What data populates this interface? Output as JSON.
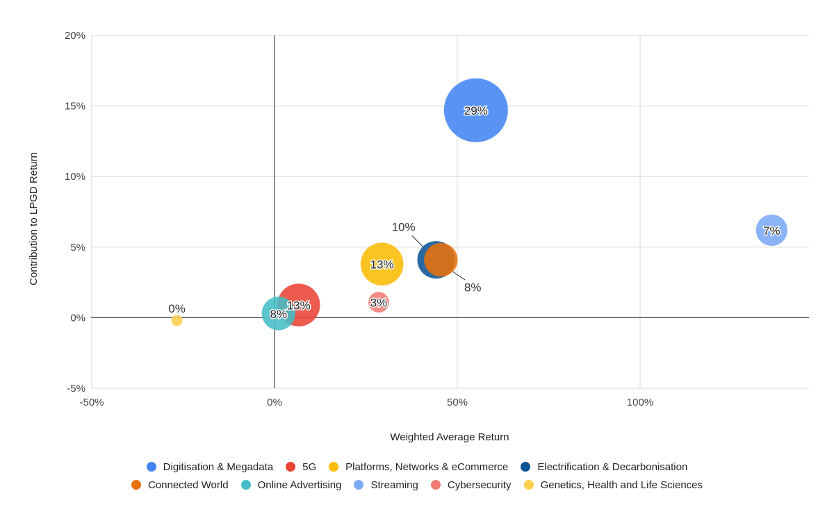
{
  "chart_data": {
    "type": "scatter",
    "subtype": "bubble",
    "title": "",
    "xlabel": "Weighted Average Return",
    "ylabel": "Contribution to LPGD Return",
    "xlim": [
      -50,
      146
    ],
    "ylim": [
      -5,
      20
    ],
    "x_ticks": [
      -50,
      0,
      50,
      100
    ],
    "x_tick_labels": [
      "-50%",
      "0%",
      "50%",
      "100%"
    ],
    "y_ticks": [
      -5,
      0,
      5,
      10,
      15,
      20
    ],
    "y_tick_labels": [
      "-5%",
      "0%",
      "5%",
      "10%",
      "15%",
      "20%"
    ],
    "grid": true,
    "legend_position": "bottom",
    "series": [
      {
        "name": "Digitisation & Megadata",
        "color": "#4285f4",
        "x": 55.1,
        "y": 14.7,
        "size": 29,
        "label": "29%"
      },
      {
        "name": "5G",
        "color": "#ea4335",
        "x": 6.6,
        "y": 0.9,
        "size": 13,
        "label": "13%"
      },
      {
        "name": "Platforms, Networks & eCommerce",
        "color": "#fbbc04",
        "x": 29.4,
        "y": 3.8,
        "size": 13,
        "label": "13%"
      },
      {
        "name": "Electrification & Decarbonisation",
        "color": "#0b5394",
        "x": 44.2,
        "y": 4.1,
        "size": 10,
        "label": "10%",
        "callout": "upper-left"
      },
      {
        "name": "Connected World",
        "color": "#e8710a",
        "x": 45.5,
        "y": 4.1,
        "size": 8,
        "label": "8%",
        "callout": "lower-right"
      },
      {
        "name": "Online Advertising",
        "color": "#46bdc6",
        "x": 1.1,
        "y": 0.3,
        "size": 8,
        "label": "8%"
      },
      {
        "name": "Streaming",
        "color": "#7baaf7",
        "x": 136,
        "y": 6.2,
        "size": 7,
        "label": "7%"
      },
      {
        "name": "Cybersecurity",
        "color": "#f07b72",
        "x": 28.5,
        "y": 1.1,
        "size": 3,
        "label": "3%"
      },
      {
        "name": "Genetics, Health and Life Sciences",
        "color": "#fcd04f",
        "x": -26.7,
        "y": -0.2,
        "size": 0,
        "label": "0%",
        "callout": "above"
      }
    ]
  },
  "legend_rows": [
    [
      0,
      1,
      2,
      3
    ],
    [
      4,
      5,
      6,
      7,
      8
    ]
  ]
}
